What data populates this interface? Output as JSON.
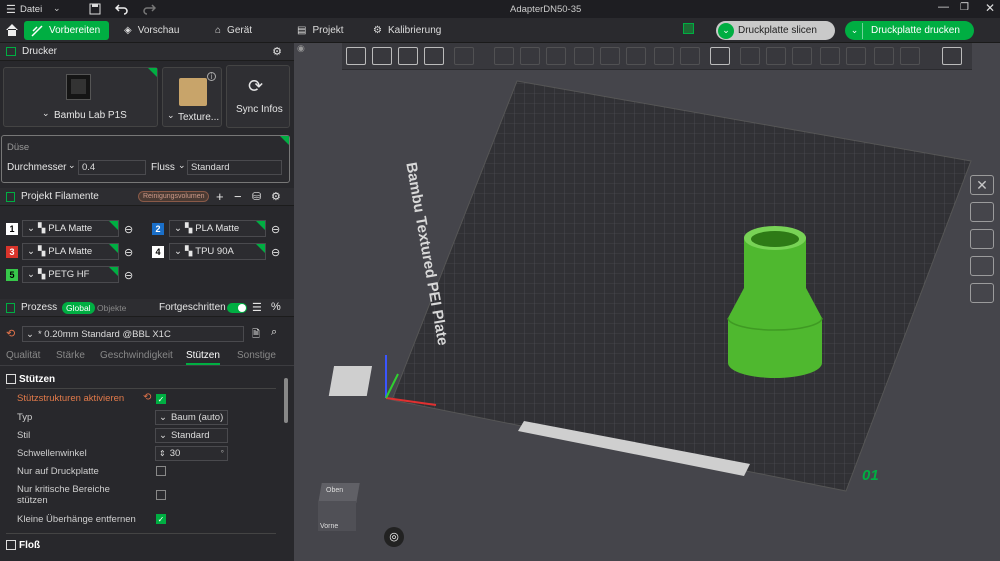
{
  "titlebar": {
    "menu_label": "Datei",
    "window_title": "AdapterDN50-35"
  },
  "toolbar": {
    "tabs": [
      {
        "label": "Vorbereiten",
        "icon": "prepare-icon"
      },
      {
        "label": "Vorschau",
        "icon": "preview-icon"
      },
      {
        "label": "Gerät",
        "icon": "device-icon"
      },
      {
        "label": "Projekt",
        "icon": "project-icon"
      },
      {
        "label": "Kalibrierung",
        "icon": "calibration-icon"
      }
    ],
    "slice_label": "Druckplatte slicen",
    "print_label": "Druckplatte drucken"
  },
  "printer": {
    "section_title": "Drucker",
    "printer_name": "Bambu Lab P1S",
    "plate_label": "Texture...",
    "sync_label": "Sync Infos"
  },
  "nozzle": {
    "title": "Düse",
    "diameter_label": "Durchmesser",
    "diameter_value": "0.4",
    "flow_label": "Fluss",
    "flow_value": "Standard"
  },
  "filaments": {
    "section_title": "Projekt Filamente",
    "badge": "Reinigungsvolumen",
    "items": [
      {
        "num": "1",
        "name": "PLA Matte",
        "color": "#ffffff"
      },
      {
        "num": "2",
        "name": "PLA Matte",
        "color": "#1a6fc9"
      },
      {
        "num": "3",
        "name": "PLA Matte",
        "color": "#d9342b"
      },
      {
        "num": "4",
        "name": "TPU 90A",
        "color": "#ffffff"
      },
      {
        "num": "5",
        "name": "PETG HF",
        "color": "#37c84a"
      }
    ]
  },
  "process": {
    "section_title": "Prozess",
    "toggle_global": "Global",
    "toggle_objects": "Objekte",
    "advanced_label": "Fortgeschritten",
    "profile": "* 0.20mm Standard @BBL X1C",
    "tabs": [
      "Qualität",
      "Stärke",
      "Geschwindigkeit",
      "Stützen",
      "Sonstige"
    ],
    "active_tab": "Stützen"
  },
  "supports": {
    "group_title": "Stützen",
    "enable_label": "Stützstrukturen aktivieren",
    "type_label": "Typ",
    "type_value": "Baum (auto)",
    "style_label": "Stil",
    "style_value": "Standard",
    "threshold_label": "Schwellenwinkel",
    "threshold_value": "30",
    "threshold_unit": "°",
    "buildplate_only_label": "Nur auf Druckplatte",
    "critical_only_label": "Nur kritische Bereiche stützen",
    "remove_overhangs_label": "Kleine Überhänge entfernen",
    "raft_title": "Floß"
  },
  "viewport": {
    "plate_text": "Bambu Textured PEI Plate",
    "plate_number": "01",
    "cube_top": "Oben",
    "cube_front": "Vorne",
    "colors": {
      "model": "#4fb82f",
      "accent": "#00ae42"
    }
  }
}
